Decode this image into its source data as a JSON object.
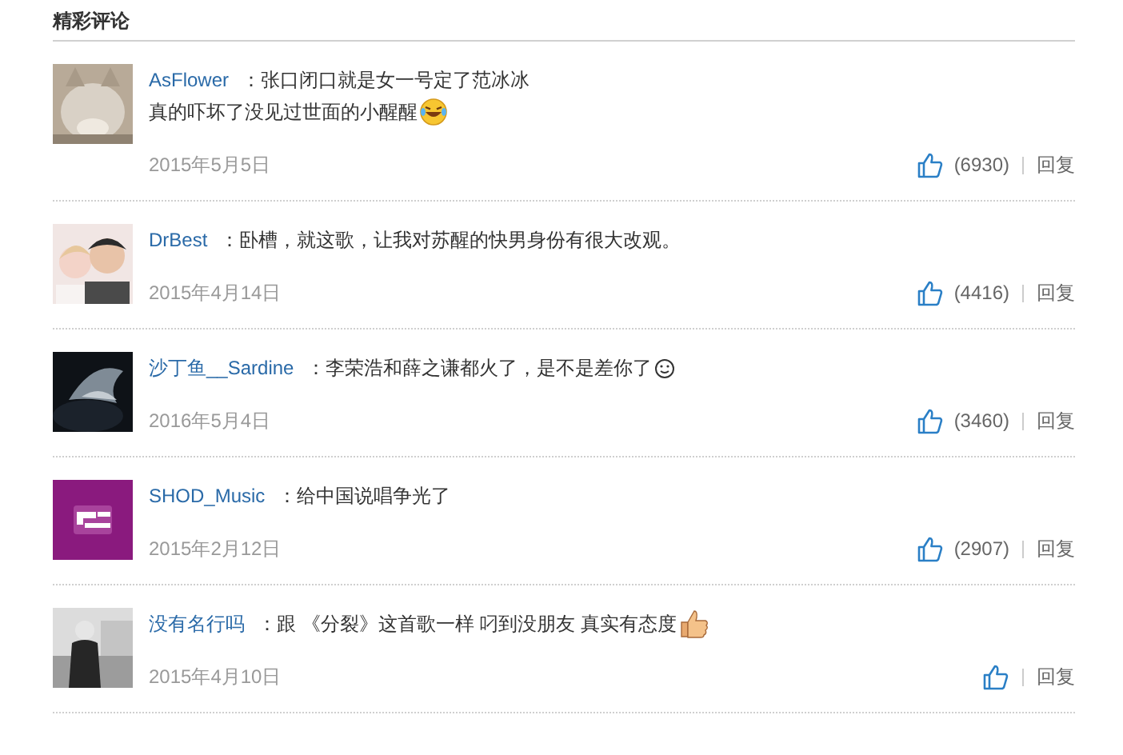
{
  "section_title": "精彩评论",
  "comments": [
    {
      "avatar": {
        "kind": "picture"
      },
      "user": "AsFlower",
      "lines": [
        "：张口闭口就是女一号定了范冰冰",
        "真的吓坏了没见过世面的小醒醒"
      ],
      "emoji": {
        "kind": "laugh-cry"
      },
      "date": "2015年5月5日",
      "likes": "(6930)",
      "reply": "回复"
    },
    {
      "avatar": {
        "kind": "picture"
      },
      "user": "DrBest",
      "lines": [
        "：卧槽，就这歌，让我对苏醒的快男身份有很大改观。"
      ],
      "date": "2015年4月14日",
      "likes": "(4416)",
      "reply": "回复"
    },
    {
      "avatar": {
        "kind": "picture"
      },
      "user": "沙丁鱼__Sardine",
      "lines": [
        "：李荣浩和薛之谦都火了，是不是差你了"
      ],
      "emoji": {
        "kind": "smiley"
      },
      "date": "2016年5月4日",
      "likes": "(3460)",
      "reply": "回复"
    },
    {
      "avatar": {
        "kind": "picture"
      },
      "user": "SHOD_Music",
      "lines": [
        "：给中国说唱争光了"
      ],
      "date": "2015年2月12日",
      "likes": "(2907)",
      "reply": "回复"
    },
    {
      "avatar": {
        "kind": "picture"
      },
      "user": "没有名行吗",
      "lines": [
        "：跟 《分裂》这首歌一样 叼到没朋友 真实有态度"
      ],
      "emoji": {
        "kind": "thumbs-up"
      },
      "date": "2015年4月10日",
      "reply": "回复"
    }
  ]
}
